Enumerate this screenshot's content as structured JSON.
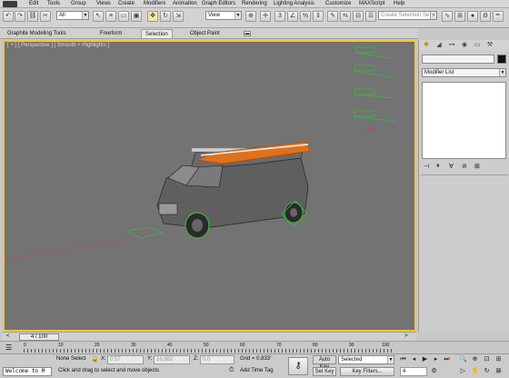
{
  "menu": {
    "items": [
      "Edit",
      "Tools",
      "Group",
      "Views",
      "Create",
      "Modifiers",
      "Animation",
      "Graph Editors",
      "Rendering",
      "Lighting Analysis",
      "Customize",
      "MAXScript",
      "Help"
    ]
  },
  "toolbar": {
    "filter_value": "All",
    "view_value": "View",
    "selection_set_placeholder": "Create Selection Se"
  },
  "ribbon": {
    "tabs": [
      "Graphite Modeling Tools",
      "Freeform",
      "Selection",
      "Object Paint"
    ],
    "active_tab": "Selection"
  },
  "viewport": {
    "label": "[ + ] [ Perspective ] [ Smooth + Highlights ]",
    "accent_color": "#f2c63a",
    "background_color": "#737373"
  },
  "command_panel": {
    "modifier_list_label": "Modifier List"
  },
  "timeline": {
    "frame_slider_label": "4 / 100",
    "ticks": [
      "0",
      "10",
      "20",
      "30",
      "40",
      "50",
      "60",
      "70",
      "80",
      "90",
      "100"
    ]
  },
  "status": {
    "maxscript_listener": "Welcome to M",
    "selection_status": "None Select",
    "x_label": "X:",
    "x_value": "0.57",
    "y_label": "Y:",
    "y_value": "16.882",
    "z_label": "Z:",
    "z_value": "0.0",
    "grid": "Grid = 0.833'",
    "prompt": "Click and drag to select and move objects",
    "add_time_tag": "Add Time Tag",
    "auto_key": "Auto Key",
    "set_key": "Set Key",
    "key_mode_value": "Selected",
    "key_filters": "Key Filters...",
    "current_frame": "4"
  }
}
